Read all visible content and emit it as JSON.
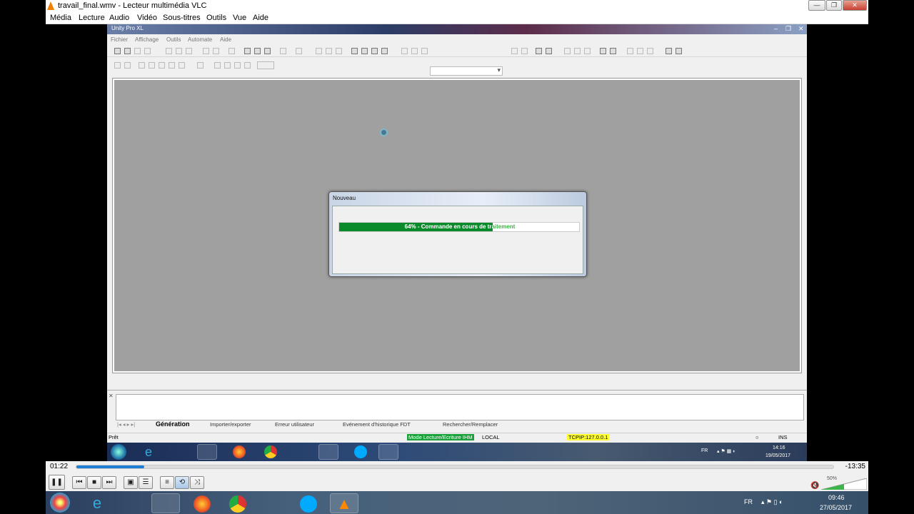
{
  "window": {
    "title": "travail_final.wmv - Lecteur multimédia VLC",
    "controls": [
      "—",
      "❐",
      "✕"
    ]
  },
  "menu": [
    "Média",
    "Lecture",
    "Audio",
    "Vidéo",
    "Sous-titres",
    "Outils",
    "Vue",
    "Aide"
  ],
  "unity": {
    "title": "Unity Pro XL",
    "menu": [
      "Fichier",
      "Affichage",
      "Outils",
      "Automate",
      "Aide"
    ],
    "dialog": {
      "title": "Nouveau",
      "progress_label": "64% - Commande en cours de traitement",
      "progress": 0.64
    },
    "tabs": [
      "Génération",
      "Importer/exporter",
      "Erreur utilisateur",
      "Evénement d'historique FDT",
      "Rechercher/Remplacer"
    ],
    "status": {
      "left": "Prêt",
      "mode": "Mode Lecture/Ecriture IHM",
      "local": "LOCAL",
      "tcp": "TCPIP:127.0.0.1",
      "ins": "INS"
    },
    "taskbar": {
      "lang": "FR",
      "time": "14:16",
      "date": "19/05/2017"
    }
  },
  "player": {
    "elapsed": "01:22",
    "remaining": "-13:35",
    "seek_fraction": 0.09,
    "volume": "50%",
    "volume_fraction": 0.5
  },
  "taskbar": {
    "lang": "FR",
    "time": "09:46",
    "date": "27/05/2017"
  },
  "colors": {
    "progress": "#0a8a2a",
    "seek": "#1f7fd4",
    "mode_badge": "#1aa23a",
    "tcp_badge": "#ffff30"
  }
}
